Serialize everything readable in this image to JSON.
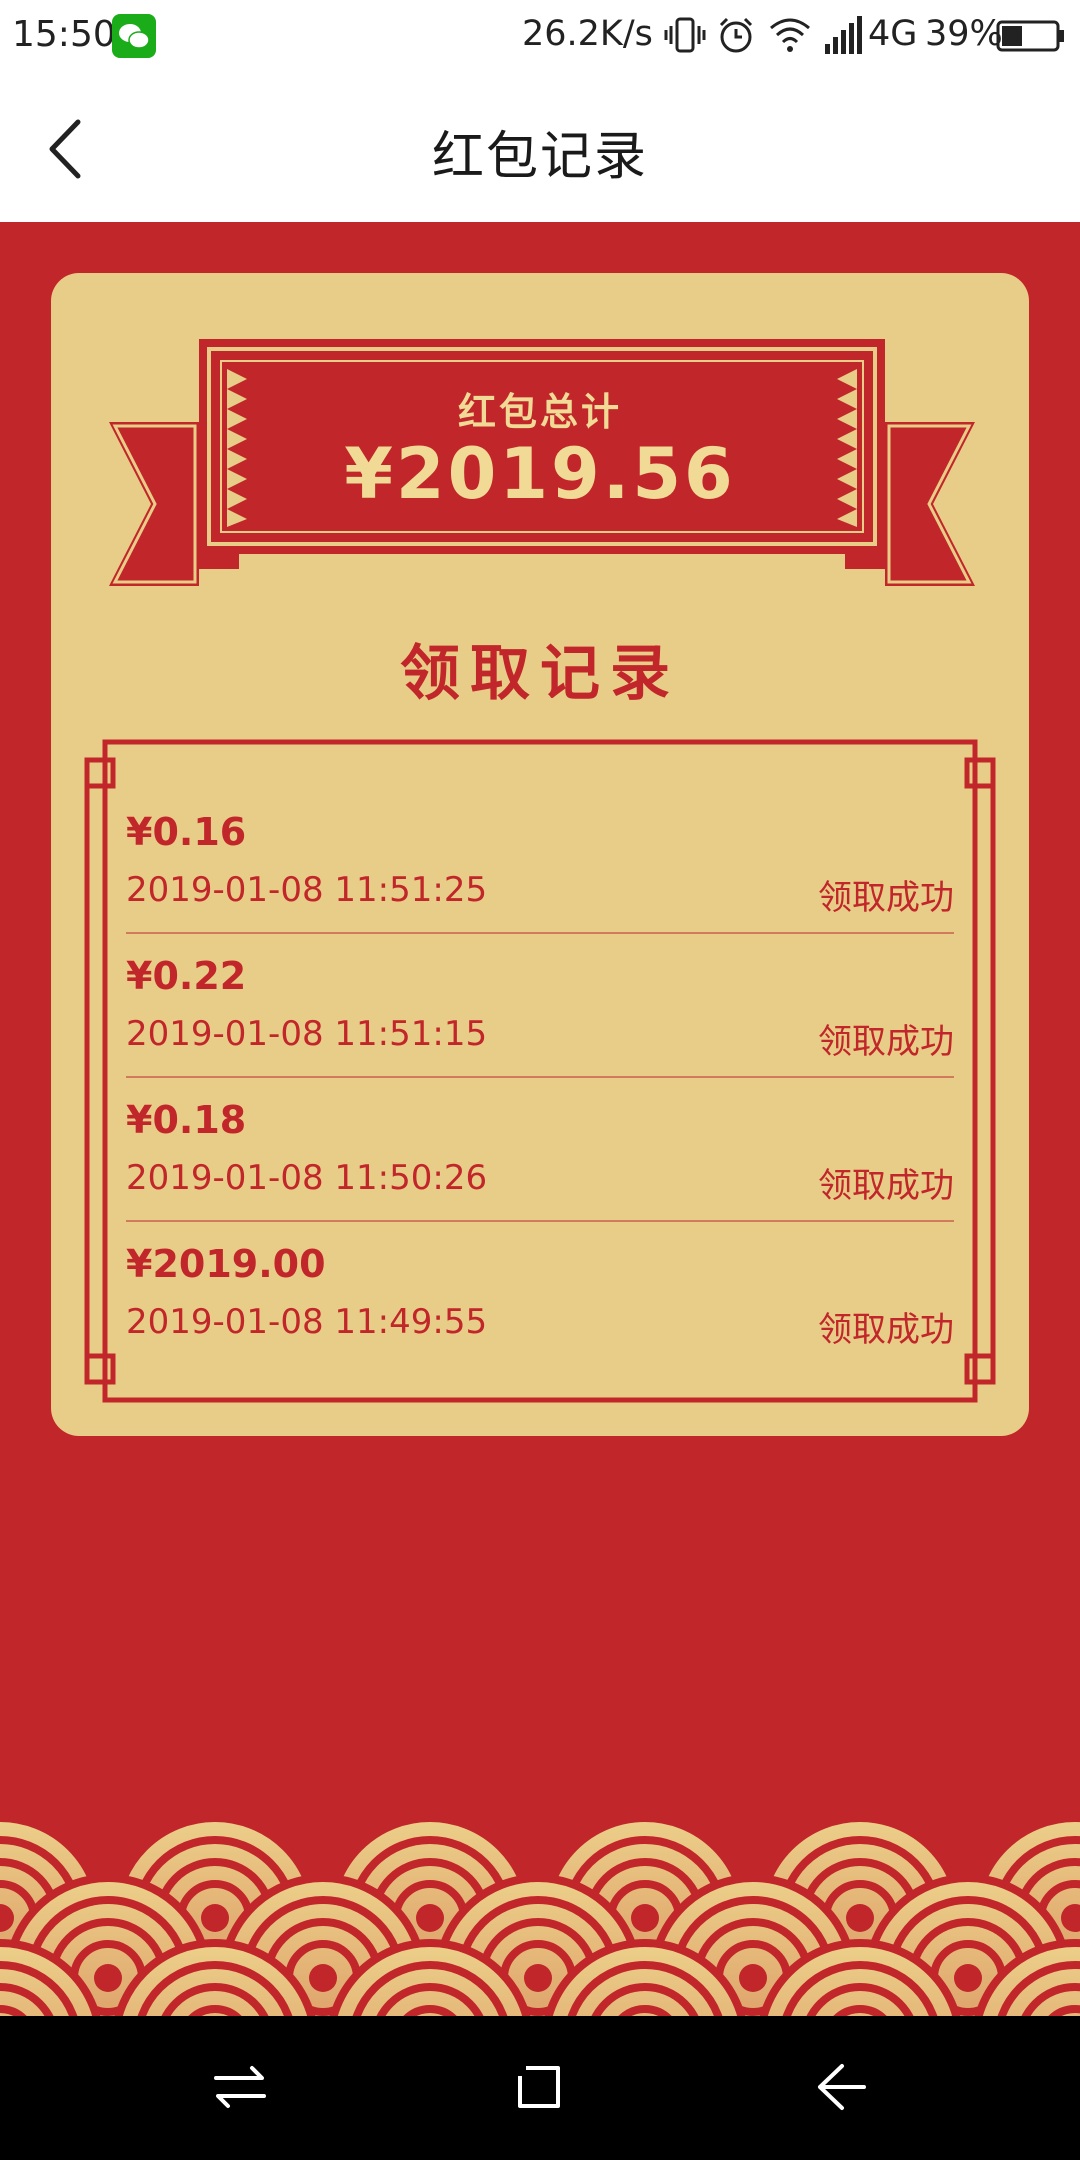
{
  "status_bar": {
    "time": "15:50",
    "net_speed": "26.2K/s",
    "network_type": "4G",
    "battery_percent": "39%",
    "battery_level": 0.39,
    "icons": [
      "wechat-icon",
      "vibrate-icon",
      "alarm-icon",
      "wifi-icon",
      "signal-icon",
      "battery-icon"
    ]
  },
  "header": {
    "title": "红包记录",
    "back_icon": "chevron-left-icon"
  },
  "summary": {
    "label": "红包总计",
    "total": "¥2019.56"
  },
  "records": {
    "title": "领取记录",
    "items": [
      {
        "amount": "¥0.16",
        "datetime": "2019-01-08 11:51:25",
        "status": "领取成功"
      },
      {
        "amount": "¥0.22",
        "datetime": "2019-01-08 11:51:15",
        "status": "领取成功"
      },
      {
        "amount": "¥0.18",
        "datetime": "2019-01-08 11:50:26",
        "status": "领取成功"
      },
      {
        "amount": "¥2019.00",
        "datetime": "2019-01-08 11:49:55",
        "status": "领取成功"
      }
    ]
  },
  "nav_bar": {
    "icons": [
      "recent-apps-icon",
      "home-icon",
      "back-icon"
    ]
  },
  "colors": {
    "background_red": "#c1262a",
    "card_gold": "#e8cd88",
    "banner_text": "#f1d996"
  }
}
